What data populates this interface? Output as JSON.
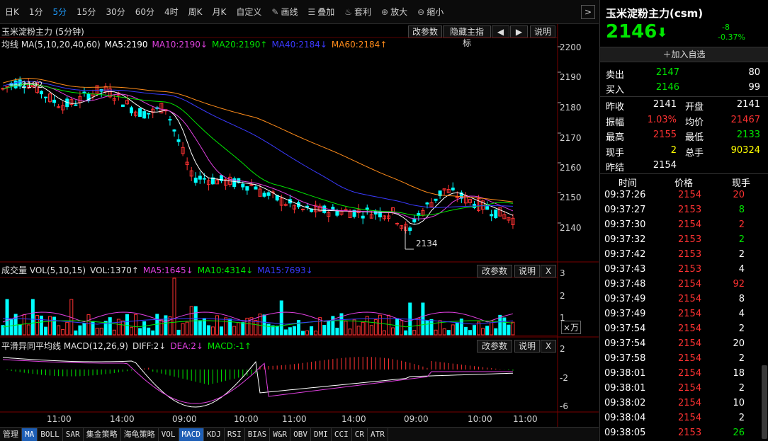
{
  "toolbar": {
    "items": [
      "日K",
      "1分",
      "5分",
      "15分",
      "30分",
      "60分",
      "4时",
      "周K",
      "月K",
      "自定义",
      "画线",
      "叠加",
      "套利",
      "放大",
      "缩小"
    ],
    "active_index": 2,
    "next": ">"
  },
  "main": {
    "title": "玉米淀粉主力 (5分钟)",
    "buttons": [
      "改参数",
      "隐藏主指标",
      "◀",
      "▶",
      "说明"
    ],
    "ma_legend": [
      {
        "text": "均线 MA(5,10,20,40,60)",
        "color": "#e0e0e0"
      },
      {
        "text": "MA5:2190",
        "color": "#ffffff"
      },
      {
        "text": "MA10:2190↓",
        "color": "#e040e0"
      },
      {
        "text": "MA20:2190↑",
        "color": "#00e600"
      },
      {
        "text": "MA40:2184↓",
        "color": "#3a3aff"
      },
      {
        "text": "MA60:2184↑",
        "color": "#ff8c1a"
      }
    ],
    "y_labels": [
      "2200",
      "2190",
      "2180",
      "2170",
      "2160",
      "2150",
      "2140"
    ],
    "high_mark": "2192",
    "low_mark": "2134"
  },
  "volume": {
    "legend": [
      {
        "text": "成交量 VOL(5,10,15)",
        "color": "#e0e0e0"
      },
      {
        "text": "VOL:1370↑",
        "color": "#e0e0e0"
      },
      {
        "text": "MA5:1645↓",
        "color": "#e040e0"
      },
      {
        "text": "MA10:4314↓",
        "color": "#00e600"
      },
      {
        "text": "MA15:7693↓",
        "color": "#3a3aff"
      }
    ],
    "buttons": [
      "改参数",
      "说明",
      "X"
    ],
    "y_labels": [
      "3",
      "2",
      "1"
    ],
    "unit": "×万"
  },
  "macd": {
    "legend": [
      {
        "text": "平滑异同平均线 MACD(12,26,9)",
        "color": "#e0e0e0"
      },
      {
        "text": "DIFF:2↓",
        "color": "#e0e0e0"
      },
      {
        "text": "DEA:2↓",
        "color": "#e040e0"
      },
      {
        "text": "MACD:-1↑",
        "color": "#00e600"
      }
    ],
    "buttons": [
      "改参数",
      "说明",
      "X"
    ],
    "y_labels": [
      "2",
      "-2",
      "-6"
    ]
  },
  "time_axis": [
    "11:00",
    "14:00",
    "09:00",
    "10:00",
    "11:00",
    "14:00",
    "09:00",
    "10:00",
    "11:00"
  ],
  "bottom_tabs": [
    "管理",
    "MA",
    "BOLL",
    "SAR",
    "集金策略",
    "海龟策略",
    "VOL",
    "MACD",
    "KDJ",
    "RSI",
    "BIAS",
    "W&R",
    "OBV",
    "DMI",
    "CCI",
    "CR",
    "ATR"
  ],
  "quote": {
    "name": "玉米淀粉主力(csm)",
    "price": "2146",
    "change": "-8",
    "change_pct": "-0.37%",
    "add_watch": "加入自选",
    "sell": {
      "label": "卖出",
      "price": "2147",
      "vol": "80"
    },
    "buy": {
      "label": "买入",
      "price": "2146",
      "vol": "99"
    },
    "stats": [
      {
        "l1": "昨收",
        "v1": "2141",
        "c1": "white",
        "l2": "开盘",
        "v2": "2141",
        "c2": "white"
      },
      {
        "l1": "振幅",
        "v1": "1.03%",
        "c1": "red",
        "l2": "均价",
        "v2": "21467",
        "c2": "red"
      },
      {
        "l1": "最高",
        "v1": "2155",
        "c1": "red",
        "l2": "最低",
        "v2": "2133",
        "c2": "green"
      },
      {
        "l1": "现手",
        "v1": "2",
        "c1": "yellow",
        "l2": "总手",
        "v2": "90324",
        "c2": "yellow"
      },
      {
        "l1": "昨结",
        "v1": "2154",
        "c1": "white",
        "l2": "",
        "v2": "",
        "c2": "white"
      }
    ],
    "ticks_header": [
      "时间",
      "价格",
      "现手"
    ],
    "ticks": [
      [
        "09:37:26",
        "2154",
        "20",
        "red"
      ],
      [
        "09:37:27",
        "2153",
        "8",
        "green"
      ],
      [
        "09:37:30",
        "2154",
        "2",
        "red"
      ],
      [
        "09:37:32",
        "2153",
        "2",
        "green"
      ],
      [
        "09:37:42",
        "2153",
        "2",
        "white"
      ],
      [
        "09:37:43",
        "2153",
        "4",
        "white"
      ],
      [
        "09:37:48",
        "2154",
        "92",
        "red"
      ],
      [
        "09:37:49",
        "2154",
        "8",
        "white"
      ],
      [
        "09:37:49",
        "2154",
        "4",
        "white"
      ],
      [
        "09:37:54",
        "2154",
        "2",
        "white"
      ],
      [
        "09:37:54",
        "2154",
        "20",
        "white"
      ],
      [
        "09:37:58",
        "2154",
        "2",
        "white"
      ],
      [
        "09:38:01",
        "2154",
        "18",
        "white"
      ],
      [
        "09:38:01",
        "2154",
        "2",
        "white"
      ],
      [
        "09:38:02",
        "2154",
        "10",
        "white"
      ],
      [
        "09:38:04",
        "2154",
        "2",
        "white"
      ],
      [
        "09:38:05",
        "2153",
        "26",
        "green"
      ]
    ]
  }
}
